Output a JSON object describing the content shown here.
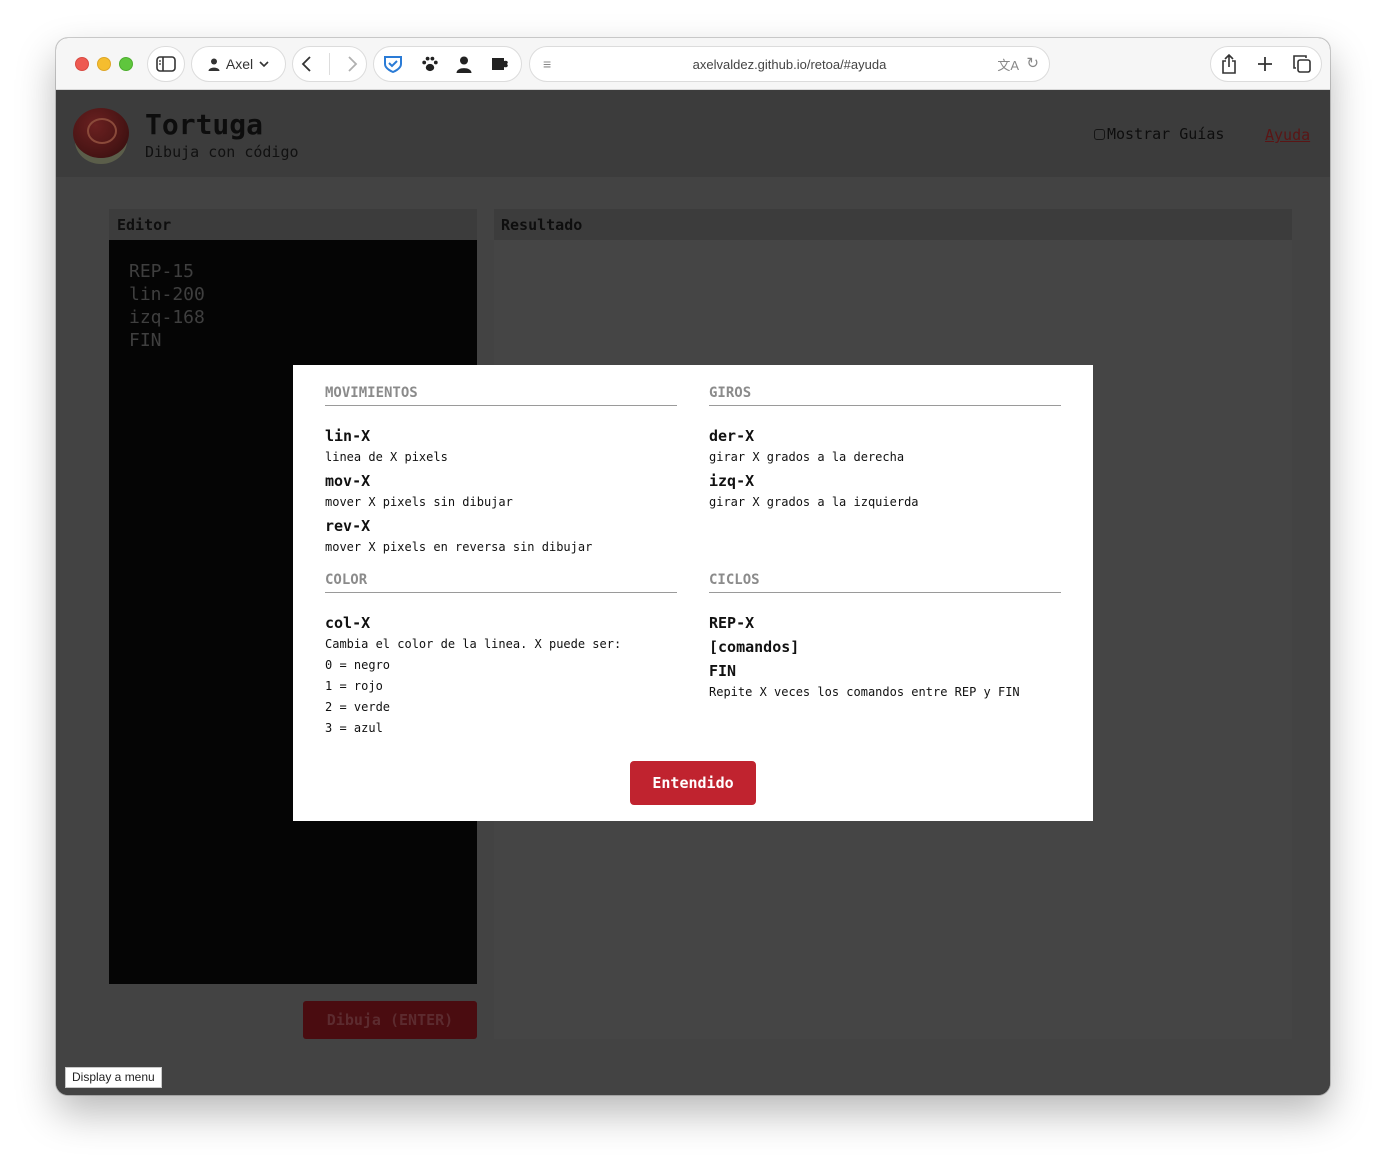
{
  "browser": {
    "profile": "Axel",
    "url": "axelvaldez.github.io/retoa/#ayuda"
  },
  "header": {
    "title": "Tortuga",
    "subtitle": "Dibuja con código",
    "guides_label": "Mostrar Guías",
    "help_link": "Ayuda"
  },
  "editor": {
    "label": "Editor",
    "lines": [
      "REP-15",
      "lin-200",
      "izq-168",
      "FIN"
    ],
    "draw_button": "Dibuja (ENTER)"
  },
  "result": {
    "label": "Resultado"
  },
  "tooltip": "Display a menu",
  "modal": {
    "movimientos": {
      "title": "MOVIMIENTOS",
      "items": [
        {
          "cmd": "lin-X",
          "desc": "linea de X pixels"
        },
        {
          "cmd": "mov-X",
          "desc": "mover X pixels sin dibujar"
        },
        {
          "cmd": "rev-X",
          "desc": "mover X pixels en reversa sin dibujar"
        }
      ]
    },
    "giros": {
      "title": "GIROS",
      "items": [
        {
          "cmd": "der-X",
          "desc": "girar X grados a la derecha"
        },
        {
          "cmd": "izq-X",
          "desc": "girar X grados a la izquierda"
        }
      ]
    },
    "color": {
      "title": "COLOR",
      "cmd": "col-X",
      "desc": "Cambia el color de la linea. X puede ser:",
      "options": [
        "0 = negro",
        "1 = rojo",
        "2 = verde",
        "3 = azul"
      ]
    },
    "ciclos": {
      "title": "CICLOS",
      "cmds": [
        "REP-X",
        "[comandos]",
        "FIN"
      ],
      "desc": "Repite X veces los comandos entre REP y FIN"
    },
    "ok_button": "Entendido"
  },
  "colors": {
    "accent": "#c0232f",
    "overlay_bg": "#434343",
    "editor_bg": "#050505"
  }
}
